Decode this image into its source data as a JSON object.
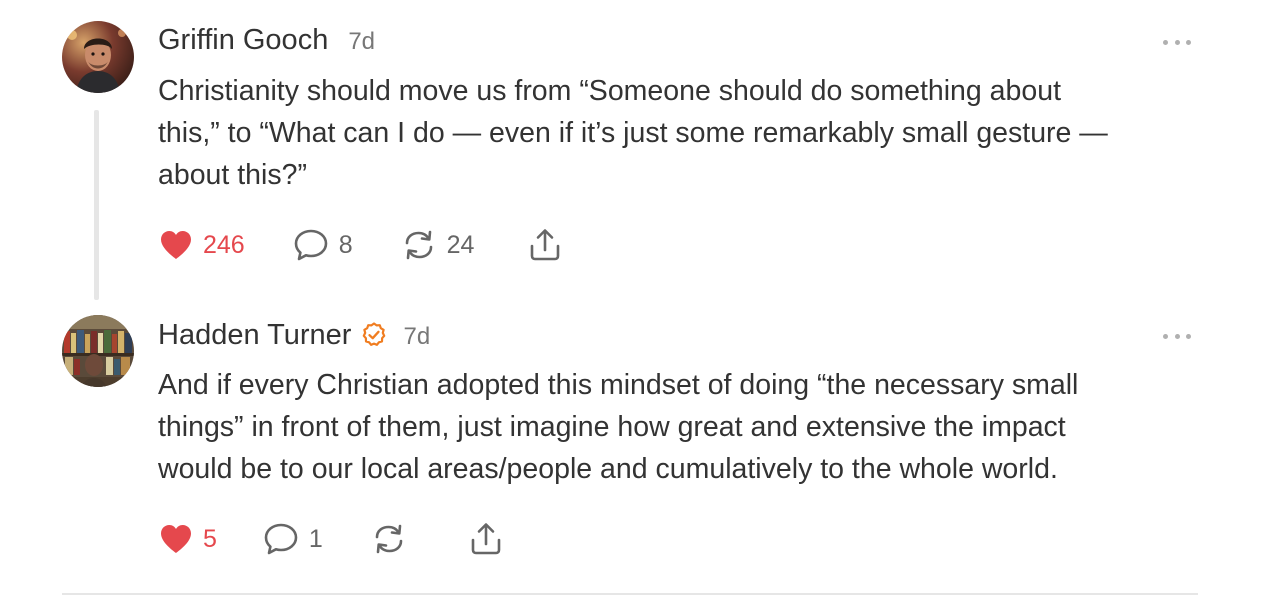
{
  "comments": [
    {
      "author": "Griffin Gooch",
      "verified": false,
      "time": "7d",
      "lines": [
        "Christianity should move us from “Someone should do something about",
        "this,” to “What can I do — even if it’s just some remarkably small gesture —",
        "about this?”"
      ],
      "likes": "246",
      "replies": "8",
      "restacks": "24",
      "liked": true,
      "accent": "#e5484d"
    },
    {
      "author": "Hadden Turner",
      "verified": true,
      "verified_color": "#f07d21",
      "time": "7d",
      "lines": [
        "And if every Christian adopted this mindset of doing “the necessary small",
        "things” in front of them, just imagine how great and extensive the impact",
        "would be to our local areas/people and cumulatively to the whole world."
      ],
      "likes": "5",
      "replies": "1",
      "restacks": "",
      "liked": true,
      "accent": "#e5484d"
    }
  ],
  "icons": {
    "like": "heart-icon",
    "reply": "speech-bubble-icon",
    "restack": "restack-arrows-icon",
    "share": "share-upload-icon",
    "more": "more-dots-icon",
    "verified": "verified-check-badge-icon"
  }
}
